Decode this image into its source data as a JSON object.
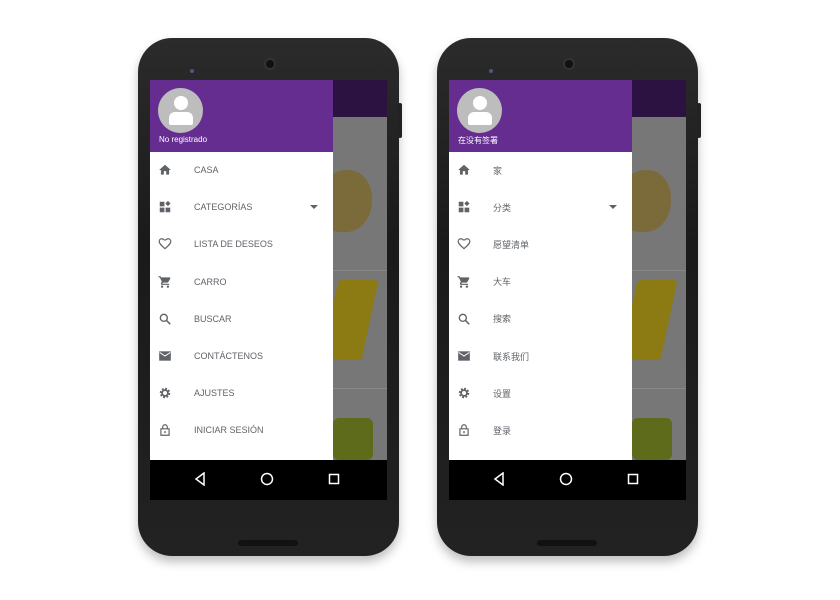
{
  "colors": {
    "drawer_header": "#662d91",
    "icon": "#5f6368",
    "nav_bar": "#000000"
  },
  "phones": [
    {
      "user_label": "No registrado",
      "menu": [
        {
          "icon": "home-icon",
          "label": "CASA"
        },
        {
          "icon": "categories-icon",
          "label": "CATEGORÍAS",
          "expandable": true
        },
        {
          "icon": "heart-icon",
          "label": "LISTA DE DESEOS"
        },
        {
          "icon": "cart-icon",
          "label": "CARRO"
        },
        {
          "icon": "search-icon",
          "label": "BUSCAR"
        },
        {
          "icon": "mail-icon",
          "label": "CONTÁCTENOS"
        },
        {
          "icon": "gear-icon",
          "label": "AJUSTES"
        },
        {
          "icon": "lock-icon",
          "label": "INICIAR SESIÓN"
        }
      ]
    },
    {
      "user_label": "在没有签署",
      "menu": [
        {
          "icon": "home-icon",
          "label": "家"
        },
        {
          "icon": "categories-icon",
          "label": "分类",
          "expandable": true
        },
        {
          "icon": "heart-icon",
          "label": "愿望清单"
        },
        {
          "icon": "cart-icon",
          "label": "大车"
        },
        {
          "icon": "search-icon",
          "label": "搜索"
        },
        {
          "icon": "mail-icon",
          "label": "联系我们"
        },
        {
          "icon": "gear-icon",
          "label": "设置"
        },
        {
          "icon": "lock-icon",
          "label": "登录"
        }
      ]
    }
  ],
  "nav_buttons": [
    "back-icon",
    "home-circle-icon",
    "recents-icon"
  ]
}
